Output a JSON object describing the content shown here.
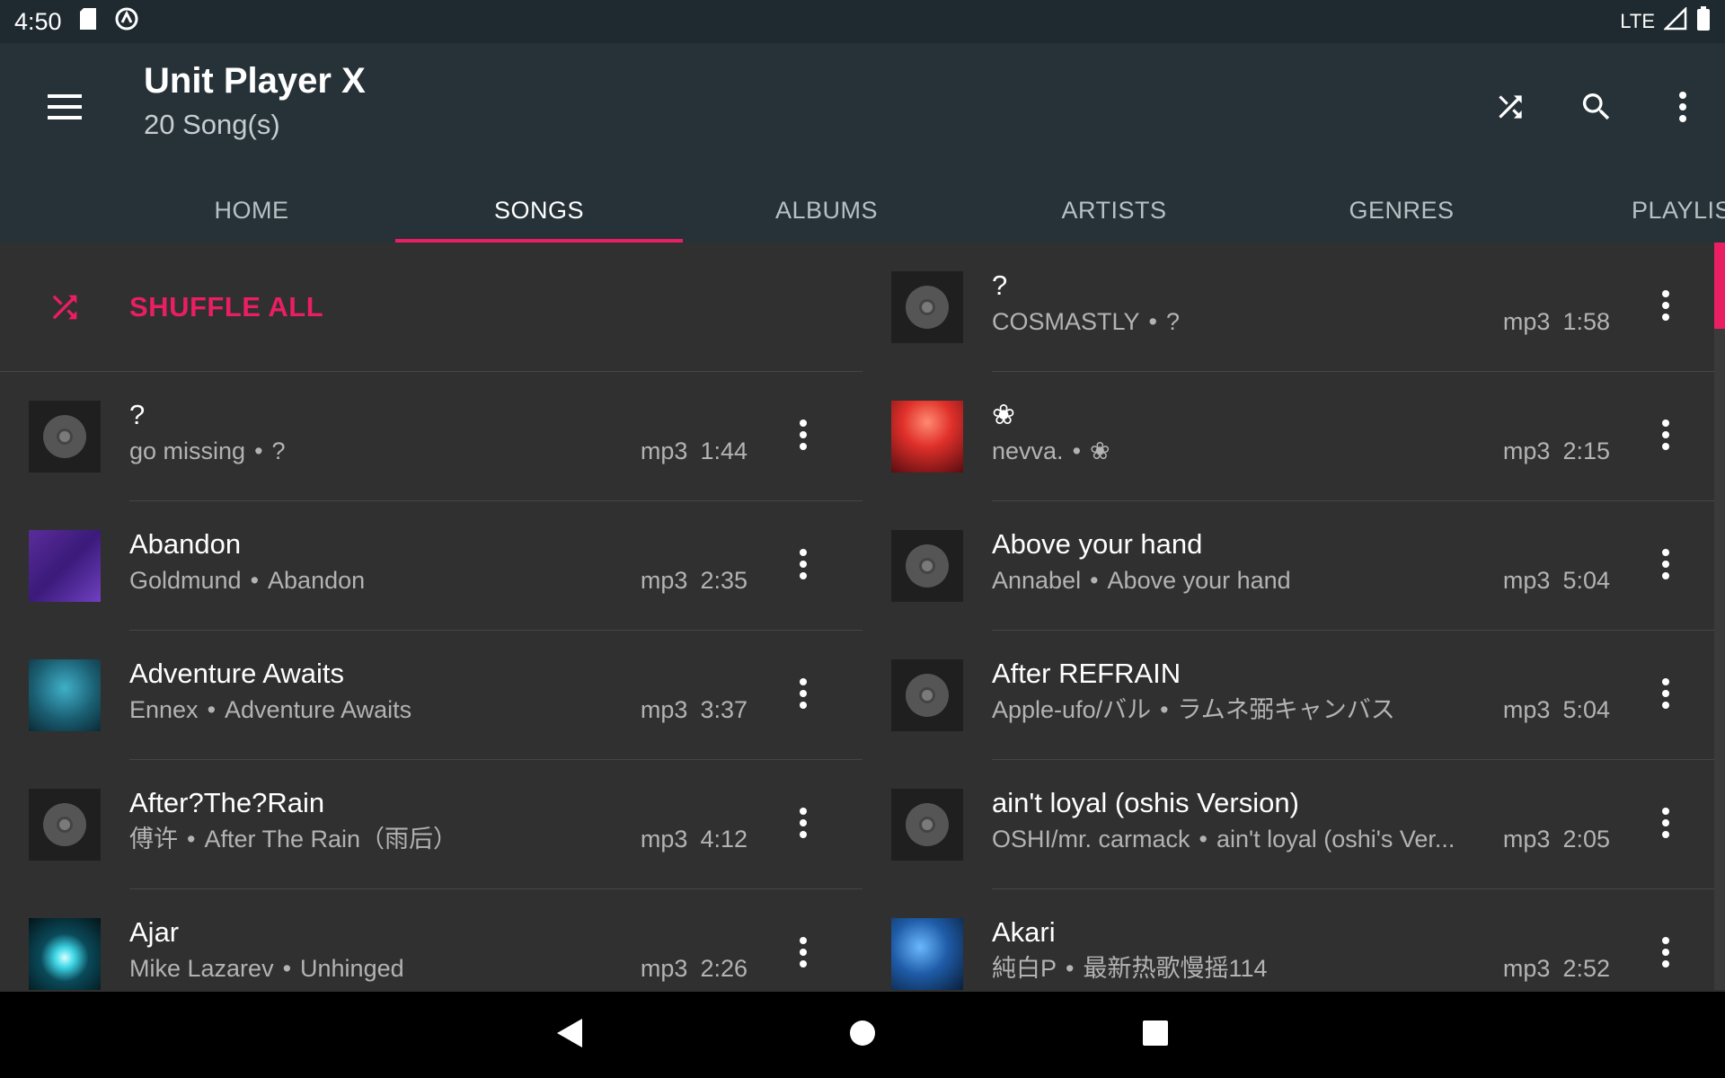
{
  "status_bar": {
    "time": "4:50",
    "network": "LTE"
  },
  "app": {
    "title": "Unit Player X",
    "subtitle": "20 Song(s)"
  },
  "tabs": [
    {
      "label": "HOME",
      "active": false
    },
    {
      "label": "SONGS",
      "active": true
    },
    {
      "label": "ALBUMS",
      "active": false
    },
    {
      "label": "ARTISTS",
      "active": false
    },
    {
      "label": "GENRES",
      "active": false
    },
    {
      "label": "PLAYLIST",
      "active": false
    }
  ],
  "shuffle_all": {
    "label": "SHUFFLE ALL"
  },
  "colors": {
    "accent": "#e91e63",
    "toolbar": "#263238",
    "background": "#303030"
  },
  "left_column": [
    {
      "title": "?",
      "artist": "go missing",
      "album": "?",
      "format": "mp3",
      "duration": "1:44",
      "cover": "disc"
    },
    {
      "title": "Abandon",
      "artist": "Goldmund",
      "album": "Abandon",
      "format": "mp3",
      "duration": "2:35",
      "cover": "purple"
    },
    {
      "title": "Adventure Awaits",
      "artist": "Ennex",
      "album": "Adventure Awaits",
      "format": "mp3",
      "duration": "3:37",
      "cover": "teal"
    },
    {
      "title": "After?The?Rain",
      "artist": "傅许",
      "album": "After The Rain（雨后）",
      "format": "mp3",
      "duration": "4:12",
      "cover": "disc"
    },
    {
      "title": "Ajar",
      "artist": "Mike Lazarev",
      "album": "Unhinged",
      "format": "mp3",
      "duration": "2:26",
      "cover": "cyanlight"
    }
  ],
  "right_column": [
    {
      "title": "?",
      "artist": "COSMASTLY",
      "album": "?",
      "format": "mp3",
      "duration": "1:58",
      "cover": "disc"
    },
    {
      "title": "❀",
      "artist": "nevva.",
      "album": "❀",
      "format": "mp3",
      "duration": "2:15",
      "cover": "red"
    },
    {
      "title": "Above your hand",
      "artist": "Annabel",
      "album": "Above your hand",
      "format": "mp3",
      "duration": "5:04",
      "cover": "disc"
    },
    {
      "title": "After REFRAIN",
      "artist": "Apple-ufo/バル",
      "album": "ラムネ弼キャンバス",
      "format": "mp3",
      "duration": "5:04",
      "cover": "disc"
    },
    {
      "title": "ain't loyal (oshis Version)",
      "artist": "OSHI/mr. carmack",
      "album": "ain't loyal (oshi's Ver...",
      "format": "mp3",
      "duration": "2:05",
      "cover": "disc"
    },
    {
      "title": "Akari",
      "artist": "純白P",
      "album": "最新热歌慢摇114",
      "format": "mp3",
      "duration": "2:52",
      "cover": "blue"
    }
  ],
  "icons": {
    "menu": "hamburger-icon",
    "shuffle": "shuffle-icon",
    "search": "search-icon",
    "overflow": "more-vert-icon",
    "back": "back-triangle-icon",
    "home": "home-circle-icon",
    "recents": "recents-square-icon"
  }
}
